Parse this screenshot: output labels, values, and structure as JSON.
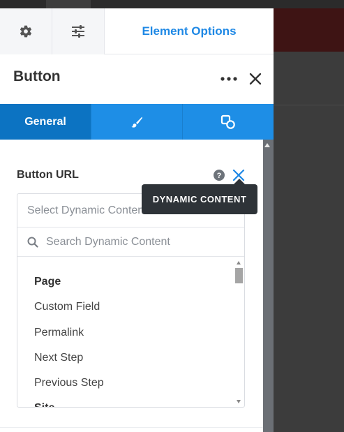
{
  "topbar": {
    "settings_icon": "gear-icon",
    "sliders_icon": "sliders-icon",
    "title": "Element Options"
  },
  "header": {
    "title": "Button",
    "more_icon": "more-horizontal-icon",
    "close_icon": "close-icon"
  },
  "tabs": [
    {
      "label": "General",
      "icon": ""
    },
    {
      "label": "",
      "icon": "brush-icon"
    },
    {
      "label": "",
      "icon": "shapes-icon"
    }
  ],
  "field": {
    "label": "Button URL",
    "help_icon": "help-circle-icon",
    "dynamic_close_icon": "close-icon"
  },
  "dropdown": {
    "select_placeholder": "Select Dynamic Content",
    "search_placeholder": "Search Dynamic Content",
    "group": "Page",
    "items": [
      "Custom Field",
      "Permalink",
      "Next Step",
      "Previous Step"
    ],
    "next_group_partial": "Site"
  },
  "tooltip": {
    "text": "DYNAMIC CONTENT"
  },
  "colors": {
    "accent": "#1e88e5",
    "tab_bar": "#1e8ee6",
    "tab_active": "#0c73c2",
    "tooltip_bg": "#2e3338"
  }
}
